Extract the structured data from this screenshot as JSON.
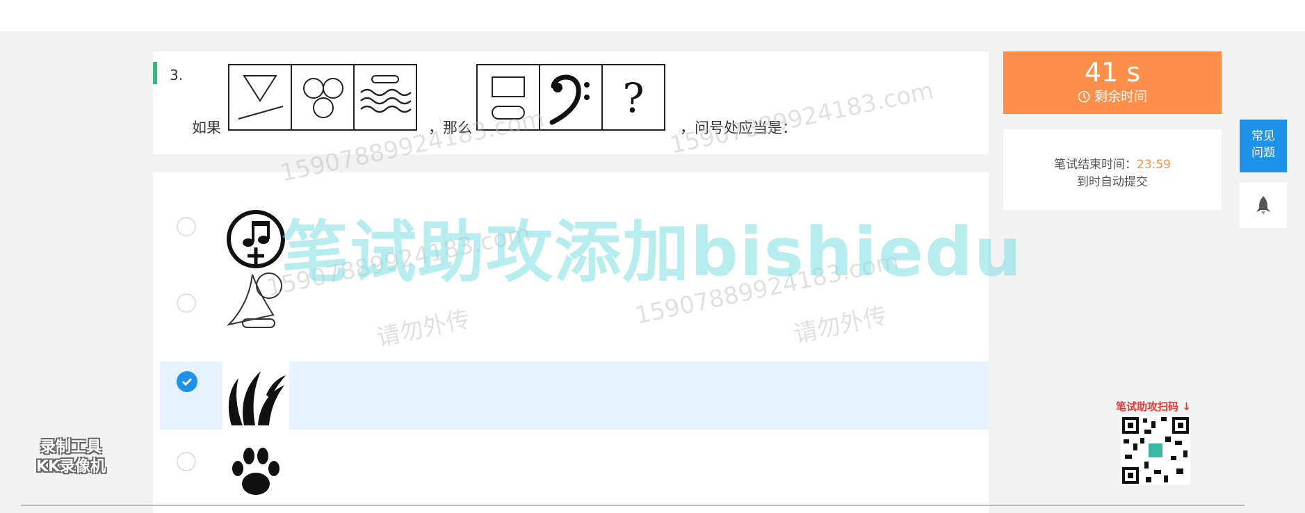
{
  "question": {
    "number": "3.",
    "prefix": "如果",
    "middle": "，那么",
    "suffix": "，问号处应当是："
  },
  "timer": {
    "seconds": "41 s",
    "label": "剩余时间"
  },
  "end_info": {
    "label": "笔试结束时间：",
    "time": "23:59",
    "note": "到时自动提交"
  },
  "faq": {
    "line1": "常见",
    "line2": "问题"
  },
  "options": {
    "selected_index": 2
  },
  "watermarks": {
    "big": "笔试助攻添加bishiedu",
    "small": [
      "15907889924183.com",
      "请勿外传",
      "15907889924183.com",
      "请勿外传"
    ],
    "qr_label": "笔试助攻扫码 ↓",
    "recorder_line1": "录制工具",
    "recorder_line2": "KK录像机"
  },
  "colors": {
    "timer_bg": "#fe8f4a",
    "accent_blue": "#1e92e8",
    "question_bar": "#35b87a",
    "selected_row": "#e5f1fe"
  },
  "icons": [
    "triangle-line-icon",
    "three-circles-icon",
    "waves-icon",
    "rectangles-icon",
    "bass-clef-icon",
    "question-mark-icon",
    "music-note-plus-icon",
    "sail-circle-icon",
    "flame-leaves-icon",
    "paw-icon",
    "clock-icon",
    "rocket-icon",
    "check-icon",
    "qr-code-icon"
  ]
}
